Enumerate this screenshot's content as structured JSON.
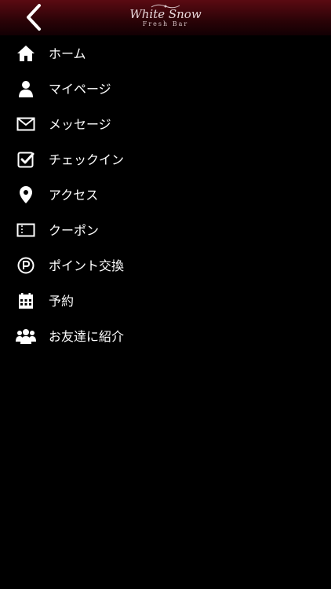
{
  "header": {
    "back_icon": "chevron-left-icon",
    "logo": {
      "name": "White Snow",
      "subtitle": "Fresh Bar"
    },
    "accent_color": "#5a0a12"
  },
  "menu": {
    "items": [
      {
        "label": "ホーム",
        "icon": "home-icon"
      },
      {
        "label": "マイページ",
        "icon": "user-icon"
      },
      {
        "label": "メッセージ",
        "icon": "envelope-icon"
      },
      {
        "label": "チェックイン",
        "icon": "checkbox-icon"
      },
      {
        "label": "アクセス",
        "icon": "map-pin-icon"
      },
      {
        "label": "クーポン",
        "icon": "ticket-icon"
      },
      {
        "label": "ポイント交換",
        "icon": "point-icon"
      },
      {
        "label": "予約",
        "icon": "calendar-icon"
      },
      {
        "label": "お友達に紹介",
        "icon": "group-icon"
      }
    ]
  }
}
